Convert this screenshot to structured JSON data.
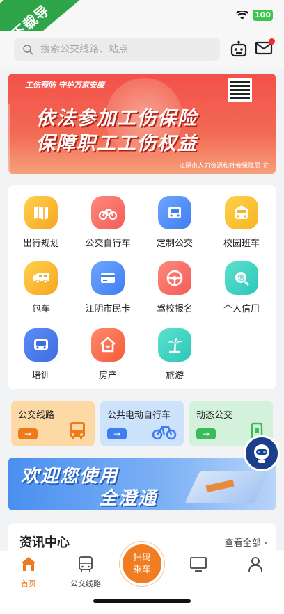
{
  "watermark": "下载导",
  "status": {
    "battery": "100"
  },
  "search": {
    "placeholder": "搜索公交线路、站点"
  },
  "banner": {
    "tagline": "工伤预防 守护万家安康",
    "line1": "依法参加工伤保险",
    "line2": "保障职工工伤权益",
    "footer": "江阴市人力资源和社会保障局 宣"
  },
  "services": [
    {
      "label": "出行规划",
      "color": "#f6a623"
    },
    {
      "label": "公交自行车",
      "color": "#f45b5b"
    },
    {
      "label": "定制公交",
      "color": "#3f7ef0"
    },
    {
      "label": "校园班车",
      "color": "#f6b623"
    },
    {
      "label": "包车",
      "color": "#f6a623"
    },
    {
      "label": "江阴市民卡",
      "color": "#3f7ef0"
    },
    {
      "label": "驾校报名",
      "color": "#f45b5b"
    },
    {
      "label": "个人信用",
      "color": "#2cc7b8"
    },
    {
      "label": "培训",
      "color": "#3f6ee0"
    },
    {
      "label": "房产",
      "color": "#f45b3b"
    },
    {
      "label": "旅游",
      "color": "#2cc7b8"
    }
  ],
  "quick_cards": [
    {
      "title": "公交线路",
      "bg": "#fcd9a5",
      "accent": "#f07a1a"
    },
    {
      "title": "公共电动自行车",
      "bg": "#cde3fb",
      "accent": "#3f7ef0"
    },
    {
      "title": "动态公交",
      "bg": "#d4f1dc",
      "accent": "#3cba5c"
    }
  ],
  "welcome": {
    "line1": "欢迎您使用",
    "line2": "全澄通"
  },
  "news": {
    "title": "资讯中心",
    "more": "查看全部 ›"
  },
  "tabbar": {
    "home": "首页",
    "bus_lines": "公交线路",
    "scan_line1": "扫码",
    "scan_line2": "乘车"
  }
}
